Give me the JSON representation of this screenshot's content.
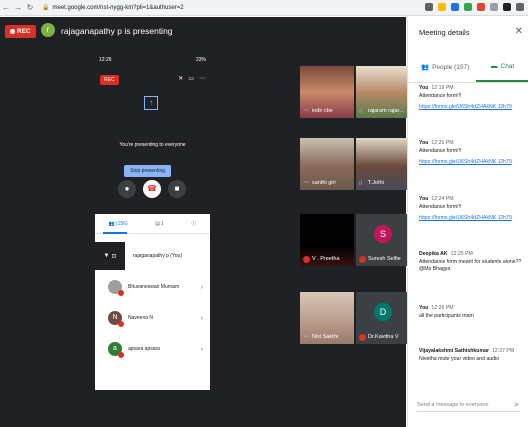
{
  "browser": {
    "url": "meet.google.com/nst-nygg-km?pli=1&authuser=2"
  },
  "stage": {
    "rec_label": "REC",
    "presenter_initial": "r",
    "presenting_text": "rajaganapathy p is presenting"
  },
  "phone": {
    "time": "12:26",
    "battery": "23%",
    "rec_label": "REC",
    "presenting_text": "You're presenting to everyone",
    "stop_label": "Stop presenting",
    "people_count": "(156)",
    "chat_badge": "1",
    "participants": [
      {
        "name": "rajaganapathy p (You)",
        "initial": ""
      },
      {
        "name": "Bhuvaneswari Murnam",
        "initial": ""
      },
      {
        "name": "Naveena N",
        "initial": "N"
      },
      {
        "name": "apsara apsara",
        "initial": "a"
      }
    ]
  },
  "tiles": [
    {
      "name": "indir cbe"
    },
    {
      "name": "rajaram rajar..."
    },
    {
      "name": "santhi giri"
    },
    {
      "name": "T.Jothi"
    },
    {
      "name": "V . Preetha"
    },
    {
      "name": "Suresh Selfie",
      "initial": "S"
    },
    {
      "name": "Nivi Sakthi"
    },
    {
      "name": "Dr.Kavitha V",
      "initial": "D"
    }
  ],
  "panel": {
    "title": "Meeting details",
    "people_label": "People (157)",
    "chat_label": "Chat",
    "compose_placeholder": "Send a message to everyone",
    "messages": [
      {
        "sender": "You",
        "time": "12:19 PM",
        "text": "Attendance form!!!",
        "link": "https://forms.gle/U6Sh4dZHAkNK J2h79"
      },
      {
        "sender": "You",
        "time": "12:21 PM",
        "text": "Attendance form!!!",
        "link": "https://forms.gle/U6Sh4dZHAkNK J2h79"
      },
      {
        "sender": "You",
        "time": "12:24 PM",
        "text": "Attendance form!!!",
        "link": "https://forms.gle/U6Sh4dZHAkNK J2h79"
      },
      {
        "sender": "Deepika AK",
        "time": "12:25 PM",
        "text": "Attendance form meant for students alone?? @Ms Bhagya",
        "link": ""
      },
      {
        "sender": "You",
        "time": "12:26 PM",
        "text": "all the participants mam",
        "link": ""
      },
      {
        "sender": "Vijayalakshmi Sathishkumar",
        "time": "12:27 PM",
        "text": "Nivetha mute your video and audio",
        "link": ""
      }
    ]
  },
  "colors": {
    "rec_red": "#d93025",
    "chat_green": "#1e8e3e",
    "link_blue": "#1a73e8",
    "stage_bg": "#202124"
  }
}
